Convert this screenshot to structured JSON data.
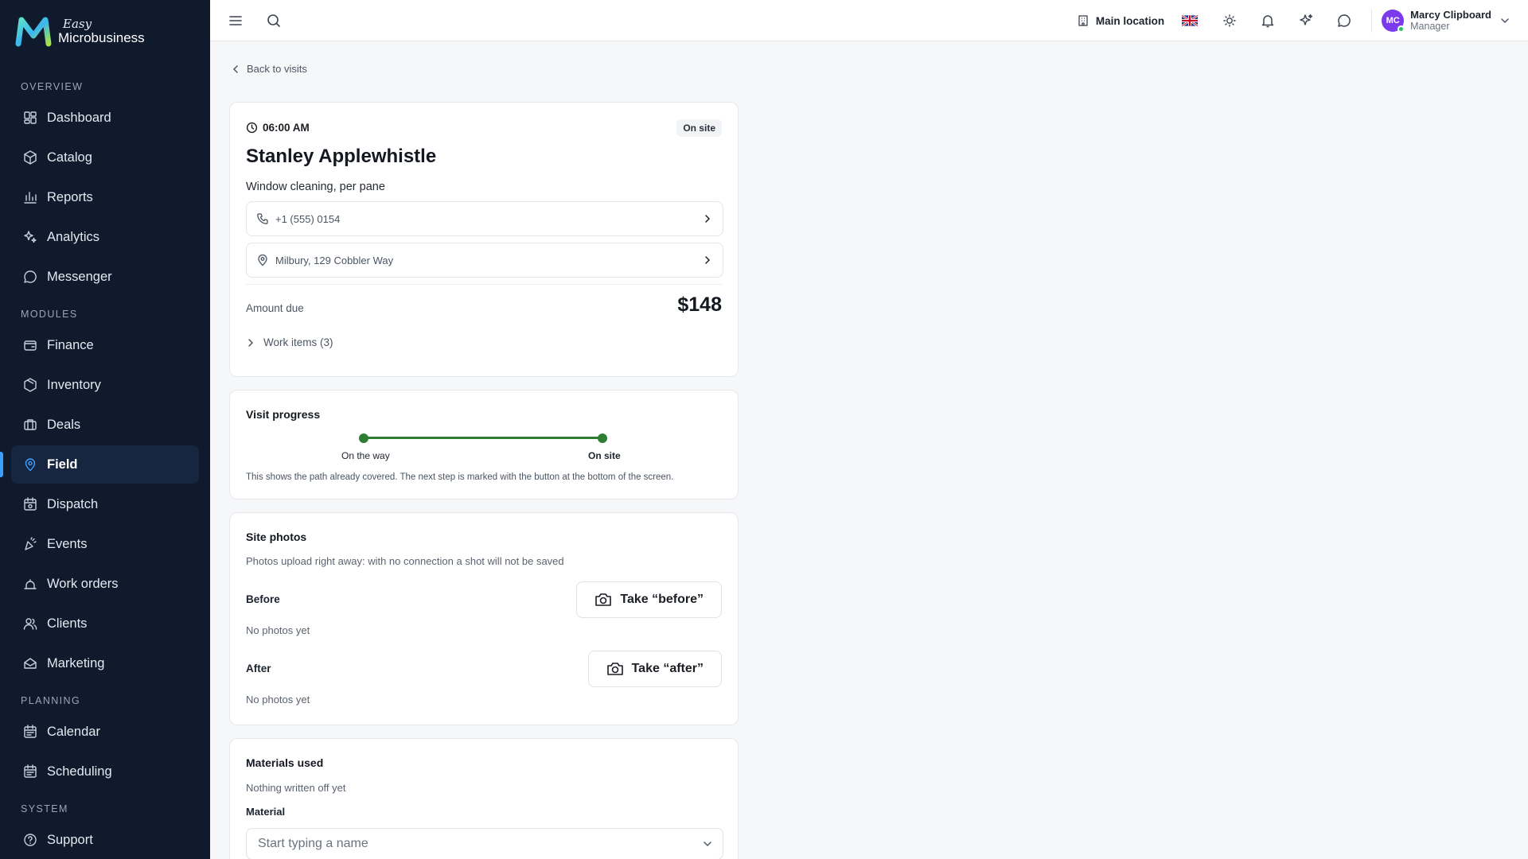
{
  "brand": {
    "easy": "Easy",
    "name": "Microbusiness"
  },
  "sidebar": {
    "sections": [
      {
        "title": "OVERVIEW",
        "items": [
          {
            "label": "Dashboard",
            "icon": "dashboard-icon"
          },
          {
            "label": "Catalog",
            "icon": "catalog-icon"
          },
          {
            "label": "Reports",
            "icon": "reports-icon"
          },
          {
            "label": "Analytics",
            "icon": "analytics-icon"
          },
          {
            "label": "Messenger",
            "icon": "messenger-icon"
          }
        ]
      },
      {
        "title": "MODULES",
        "items": [
          {
            "label": "Finance",
            "icon": "finance-icon"
          },
          {
            "label": "Inventory",
            "icon": "inventory-icon"
          },
          {
            "label": "Deals",
            "icon": "deals-icon"
          },
          {
            "label": "Field",
            "icon": "field-icon",
            "active": true
          },
          {
            "label": "Dispatch",
            "icon": "dispatch-icon"
          },
          {
            "label": "Events",
            "icon": "events-icon"
          },
          {
            "label": "Work orders",
            "icon": "work-orders-icon"
          },
          {
            "label": "Clients",
            "icon": "clients-icon"
          },
          {
            "label": "Marketing",
            "icon": "marketing-icon"
          }
        ]
      },
      {
        "title": "PLANNING",
        "items": [
          {
            "label": "Calendar",
            "icon": "calendar-icon"
          },
          {
            "label": "Scheduling",
            "icon": "scheduling-icon"
          }
        ]
      },
      {
        "title": "SYSTEM",
        "items": [
          {
            "label": "Support",
            "icon": "support-icon"
          }
        ]
      }
    ]
  },
  "topbar": {
    "location": "Main location",
    "user": {
      "initials": "MC",
      "name": "Marcy Clipboard",
      "role": "Manager"
    }
  },
  "back_label": "Back to visits",
  "visit": {
    "time": "06:00 AM",
    "status": "On site",
    "client": "Stanley Applewhistle",
    "service": "Window cleaning, per pane",
    "phone": "+1 (555) 0154",
    "address": "Milbury, 129 Cobbler Way",
    "amount_label": "Amount due",
    "amount": "$148",
    "work_items": "Work items (3)"
  },
  "progress": {
    "title": "Visit progress",
    "steps": [
      "On the way",
      "On site"
    ],
    "note": "This shows the path already covered. The next step is marked with the button at the bottom of the screen."
  },
  "photos": {
    "title": "Site photos",
    "note": "Photos upload right away: with no connection a shot will not be saved",
    "before_label": "Before",
    "before_button": "Take “before”",
    "before_empty": "No photos yet",
    "after_label": "After",
    "after_button": "Take “after”",
    "after_empty": "No photos yet"
  },
  "materials": {
    "title": "Materials used",
    "note": "Nothing written off yet",
    "field_label": "Material",
    "placeholder": "Start typing a name"
  },
  "colors": {
    "sidebar_bg": "#0f1a2c",
    "accent_green": "#2e7d32",
    "avatar": "#7c3aed"
  }
}
